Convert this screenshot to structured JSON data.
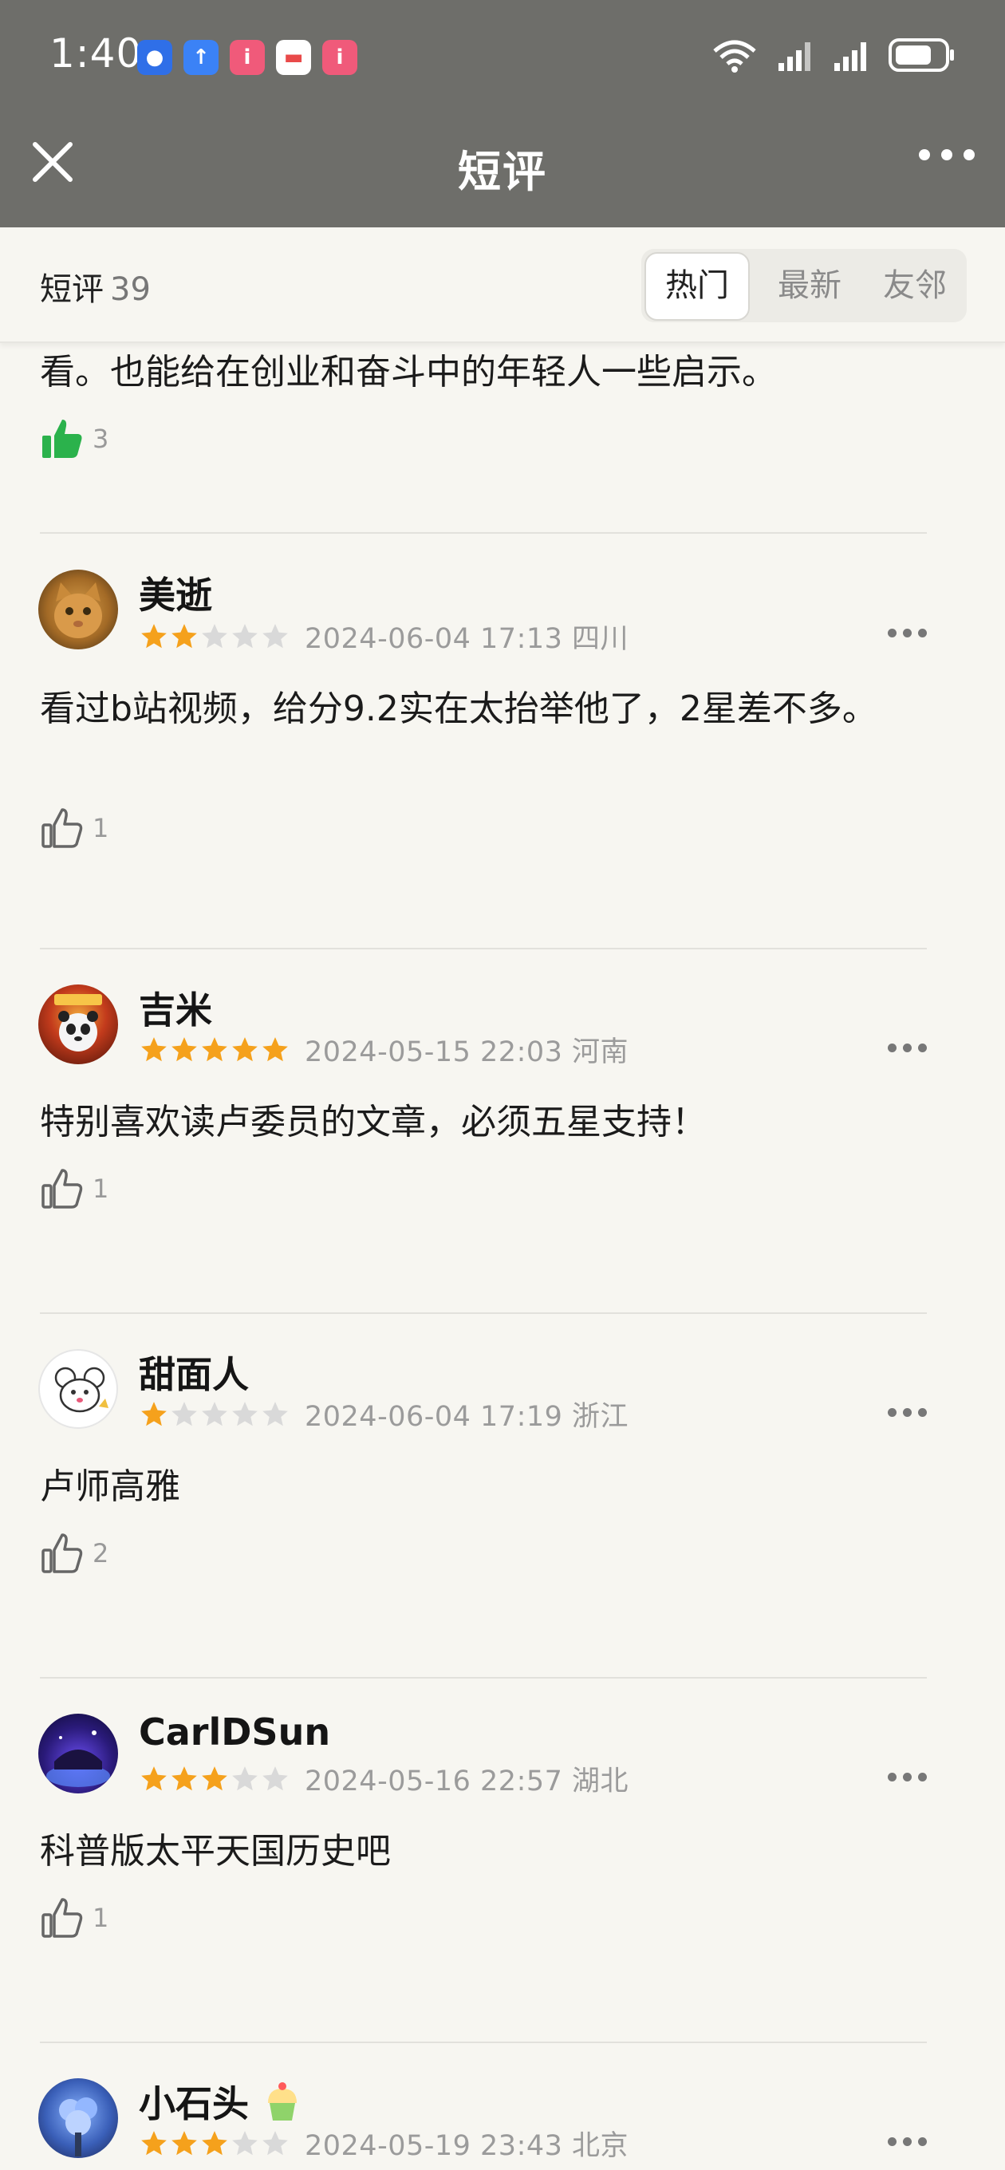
{
  "status_bar": {
    "time": "1:40",
    "app_icons": [
      "app-blue-icon",
      "upload-app-icon",
      "red-app-icon",
      "mail-app-icon",
      "red-app-icon-2"
    ],
    "battery_icon": "battery-icon",
    "wifi_icon": "wifi-icon",
    "signal_icon": "signal-icon"
  },
  "nav": {
    "title": "短评"
  },
  "filter": {
    "label": "短评",
    "count": "39",
    "tabs": [
      "热门",
      "最新",
      "友邻"
    ],
    "active_tab": "热门"
  },
  "first_partial": {
    "text": "看。也能给在创业和奋斗中的年轻人一些启示。",
    "likes": "3"
  },
  "reviews": [
    {
      "name": "美逝",
      "rating": 2,
      "meta": "2024-06-04 17:13 四川",
      "text": "看过b站视频，给分9.2实在太抬举他了，2星差不多。",
      "likes": "1"
    },
    {
      "name": "吉米",
      "rating": 5,
      "meta": "2024-05-15 22:03 河南",
      "text": "特别喜欢读卢委员的文章，必须五星支持！",
      "likes": "1"
    },
    {
      "name": "甜面人",
      "rating": 1,
      "meta": "2024-06-04 17:19 浙江",
      "text": "卢师高雅",
      "likes": "2"
    },
    {
      "name": "CarlDSun",
      "rating": 3,
      "meta": "2024-05-16 22:57 湖北",
      "text": "科普版太平天国历史吧",
      "likes": "1"
    },
    {
      "name": "小石头",
      "rating": 3,
      "meta": "2024-05-19 23:43 北京",
      "text": "",
      "likes": ""
    }
  ],
  "colors": {
    "header_bg": "#6e6e6a",
    "page_bg": "#f7f6f1",
    "star_on": "#f5a11c",
    "star_off": "#d9d9d9",
    "like_active": "#2bb24c"
  }
}
